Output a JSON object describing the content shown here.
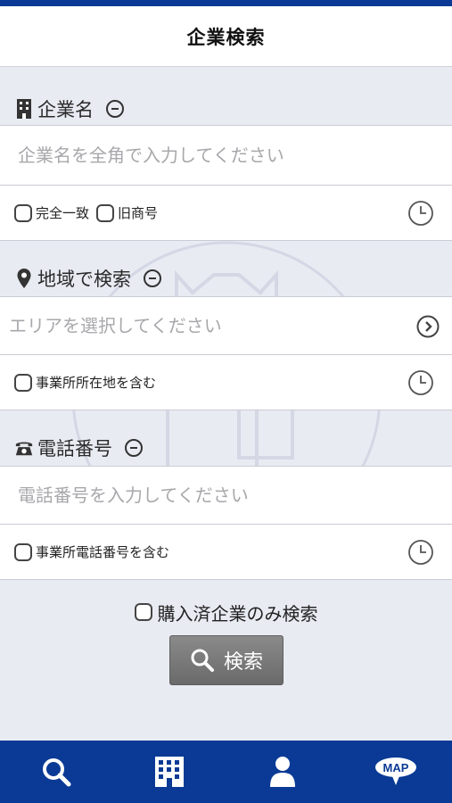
{
  "header": {
    "title": "企業検索"
  },
  "sections": {
    "company": {
      "label": "企業名",
      "placeholder": "企業名を全角で入力してください",
      "options": [
        "完全一致",
        "旧商号"
      ]
    },
    "region": {
      "label": "地域で検索",
      "placeholder": "エリアを選択してください",
      "options": [
        "事業所所在地を含む"
      ]
    },
    "phone": {
      "label": "電話番号",
      "placeholder": "電話番号を入力してください",
      "options": [
        "事業所電話番号を含む"
      ]
    }
  },
  "purchased_only_label": "購入済企業のみ検索",
  "search_button_label": "検索",
  "tabbar": {
    "items": [
      "search-icon",
      "building-icon",
      "person-icon",
      "map-icon"
    ],
    "map_label": "MAP"
  },
  "colors": {
    "accent": "#0a3a95",
    "button": "#777777",
    "background": "#e9ebf3"
  }
}
